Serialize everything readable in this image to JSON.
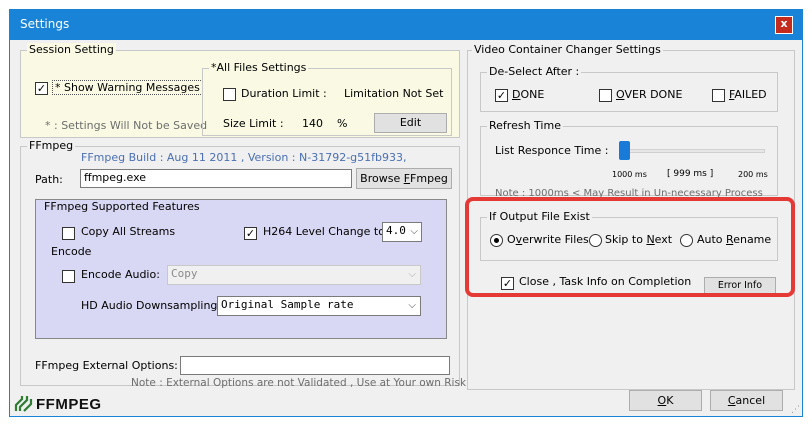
{
  "window": {
    "title": "Settings",
    "close_glyph": "x"
  },
  "session": {
    "label": "Session Setting",
    "show_warning_label": "* Show  Warning Messages",
    "show_warning_checked": "✓",
    "note": "* : Settings Will Not be Saved"
  },
  "all_files": {
    "label": "*All Files Settings",
    "duration_label": "Duration Limit :",
    "duration_value": "Limitation Not Set",
    "size_label": "Size Limit :",
    "size_value": "140",
    "size_unit": "%",
    "edit_button": "Edit"
  },
  "ffmpeg": {
    "label": "FFmpeg",
    "build": "FFmpeg Build : Aug 11 2011 , Version :  N-31792-g51fb933,",
    "path_label": "Path:",
    "path_value": "ffmpeg.exe",
    "browse_prefix": "Browse ",
    "browse_key": "F",
    "browse_suffix": "Fmpeg",
    "features_label": "FFmpeg Supported Features",
    "copy_all_streams": "Copy All Streams",
    "h264_label": "H264 Level Change to",
    "h264_checked": "✓",
    "h264_value": "4.0",
    "encode_label": "Encode",
    "encode_audio_label": "Encode Audio:",
    "encode_audio_value": "Copy",
    "hd_audio_label": "HD Audio Downsampling :",
    "hd_audio_value": "Original Sample rate",
    "external_label": "FFmpeg External Options:",
    "external_value": "",
    "external_note": "Note : External Options are not Validated , Use at Your own Risk",
    "logo_text": "FFMPEG"
  },
  "video_container": {
    "label": "Video Container Changer Settings",
    "deselect_label": "De-Select After :",
    "done_checked": "✓",
    "done_key": "D",
    "done_rest": "ONE",
    "over_done_key": "O",
    "over_done_rest": "VER DONE",
    "failed_key": "F",
    "failed_rest": "AILED",
    "refresh_label": "Refresh Time",
    "list_response_label": "List Responce Time :",
    "slider_value_fraction": 0.0,
    "slider_min": "1000 ms",
    "slider_current": "[ 999 ms ]",
    "slider_max": "200 ms",
    "note": "Note : 1000ms <  May Result in Un-necessary Process"
  },
  "output": {
    "label": "If Output File Exist",
    "overwrite_key": "v",
    "overwrite_pre": "O",
    "overwrite_post": "erwrite Files",
    "skip_pre": "Skip to ",
    "skip_key": "N",
    "skip_post": "ext",
    "rename_pre": "Auto ",
    "rename_key": "R",
    "rename_post": "ename",
    "close_task_label": "Close , Task Info on Completion",
    "close_task_checked": "✓",
    "error_info_button": "Error Info"
  },
  "footer": {
    "ok_key": "O",
    "ok_rest": "K",
    "cancel_key": "C",
    "cancel_rest": "ancel"
  },
  "colors": {
    "highlight": "#e53935",
    "titlebar": "#1883d7",
    "slider": "#1a7ad8"
  }
}
